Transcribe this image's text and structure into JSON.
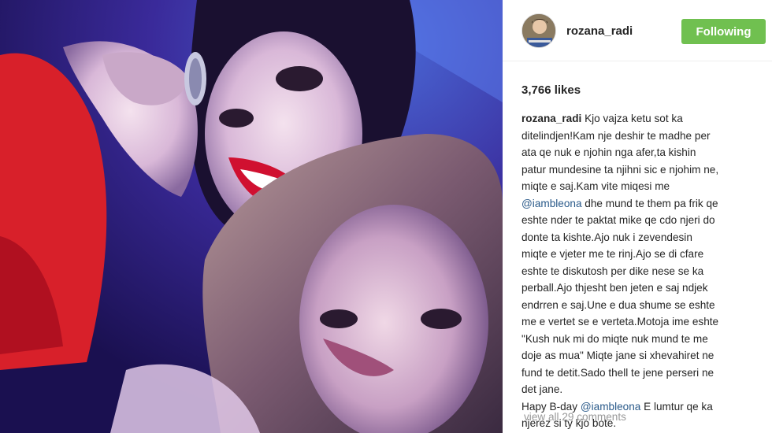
{
  "photo": {
    "description_icon": "selfie-photo"
  },
  "header": {
    "username": "rozana_radi",
    "follow_label": "Following",
    "follow_color": "#70c050"
  },
  "likes": "3,766 likes",
  "caption": {
    "author": "rozana_radi",
    "lines": [
      " Kjo vajza ketu sot ka",
      "ditelindjen!Kam nje deshir te madhe per",
      "ata qe nuk e njohin nga afer,ta kishin",
      "patur mundesine ta njihni sic e njohim ne,",
      "miqte e saj.Kam vite miqesi me",
      " dhe mund te them pa frik qe",
      "eshte nder te paktat mike qe cdo njeri do",
      "donte ta kishte.Ajo nuk i zevendesin",
      "miqte e vjeter me te rinj.Ajo se di cfare",
      "eshte te diskutosh per dike nese se ka",
      "perball.Ajo thjesht ben jeten e saj ndjek",
      "endrren e saj.Une e dua shume se eshte",
      "me e vertet se e verteta.Motoja ime eshte",
      "\"Kush nuk mi do miqte nuk mund te me",
      "doje as mua\" Miqte jane si xhevahiret ne",
      "fund te detit.Sado thell te jene perseri ne",
      "det jane.",
      "Hapy B-day ",
      " E lumtur qe ka",
      "njerez si ty kjo bote."
    ],
    "mention": "@iambleona",
    "mention_color": "#2a5a8a"
  },
  "view_comments": "view all 29 comments"
}
